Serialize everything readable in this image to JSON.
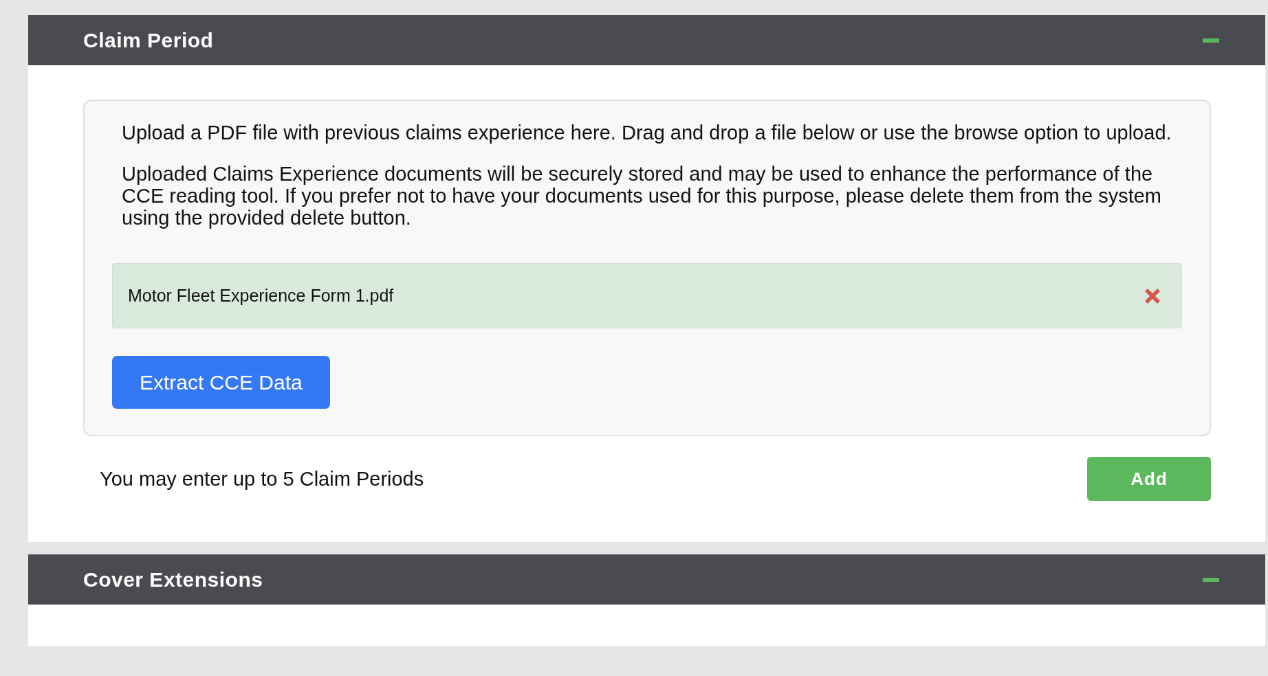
{
  "sections": [
    {
      "title": "Claim Period",
      "expanded": true,
      "upload": {
        "paragraphs": [
          "Upload a PDF file with previous claims experience here. Drag and drop a file below or use the browse option to upload.",
          "Uploaded Claims Experience documents will be securely stored and may be used to enhance the performance of the CCE reading tool. If you prefer not to have your documents used for this purpose, please delete them from the system using the provided delete button."
        ],
        "files": [
          {
            "name": "Motor Fleet Experience Form 1.pdf"
          }
        ],
        "extract_button": "Extract CCE Data"
      },
      "note": "You may enter up to 5 Claim Periods",
      "add_button": "Add"
    },
    {
      "title": "Cover Extensions",
      "expanded": true
    }
  ]
}
